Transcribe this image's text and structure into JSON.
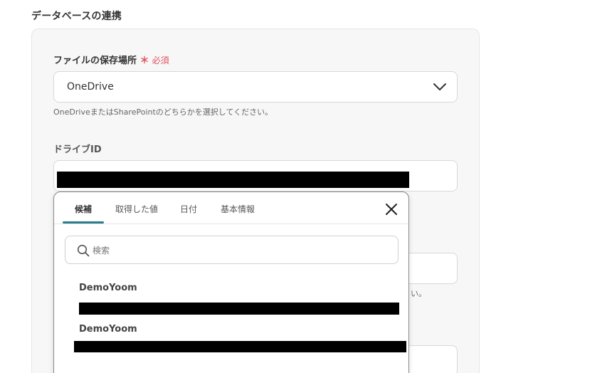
{
  "section": {
    "title": "データベースの連携"
  },
  "storage_field": {
    "label": "ファイルの保存場所",
    "required_star": "＊",
    "required_label": "必須",
    "selected_value": "OneDrive",
    "help": "OneDriveまたはSharePointのどちらかを選択してください。"
  },
  "drive_field": {
    "label": "ドライブID"
  },
  "background": {
    "fragment": "い。"
  },
  "popup": {
    "tabs": [
      {
        "label": "候補"
      },
      {
        "label": "取得した値"
      },
      {
        "label": "日付"
      },
      {
        "label": "基本情報"
      }
    ],
    "search_placeholder": "検索",
    "candidates": [
      {
        "name": "DemoYoom"
      },
      {
        "name": "DemoYoom"
      }
    ]
  },
  "colors": {
    "accent": "#2a7d8c",
    "required": "#e0505f"
  }
}
